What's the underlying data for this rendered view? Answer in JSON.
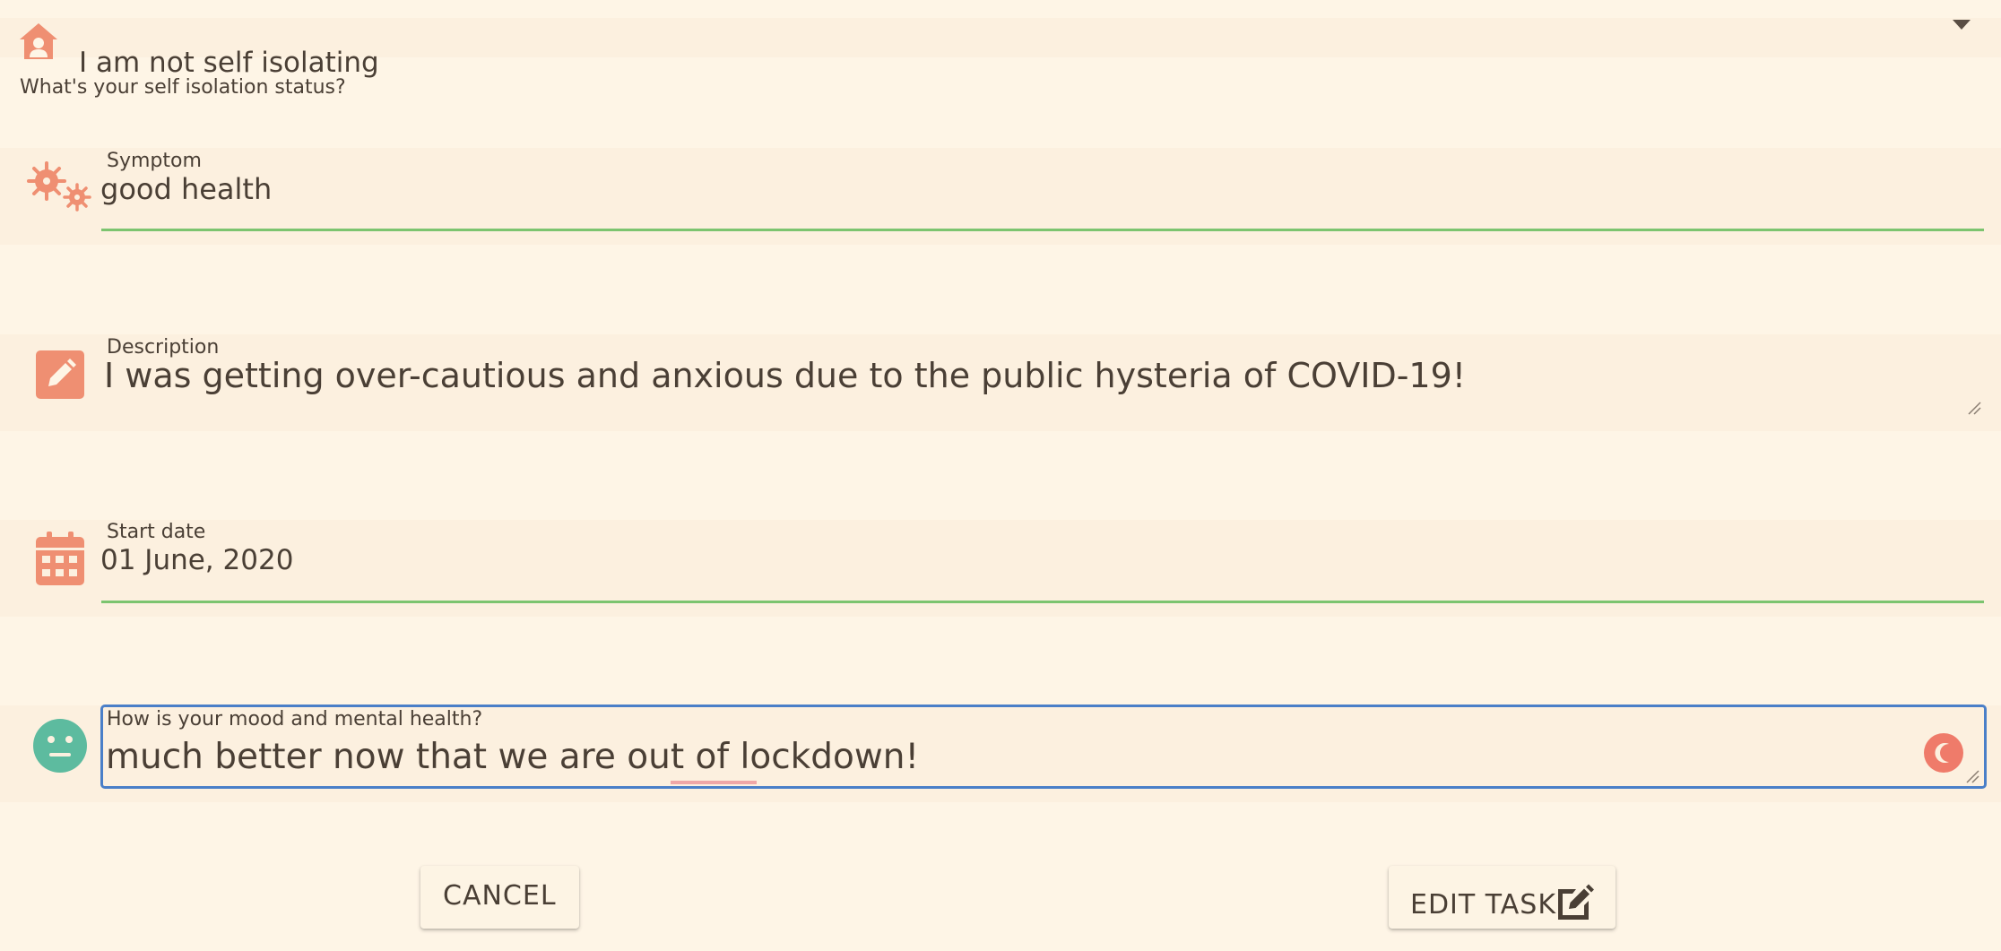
{
  "isolation": {
    "value": "I am not self isolating",
    "helper": "What's your self isolation status?",
    "icon": "home-person-icon"
  },
  "symptom": {
    "label": "Symptom",
    "value": "good health",
    "icon": "virus-icon"
  },
  "description": {
    "label": "Description",
    "value": "I was getting over-cautious and anxious due to the public hysteria of COVID-19!",
    "icon": "pencil-icon"
  },
  "start_date": {
    "label": "Start date",
    "value": "01 June, 2020",
    "icon": "calendar-icon"
  },
  "mood": {
    "label": "How is your mood and mental health?",
    "value": "much better now that we are out of lockdown!",
    "icon": "neutral-face-icon"
  },
  "actions": {
    "cancel_label": "CANCEL",
    "edit_label": "EDIT TASK"
  },
  "colors": {
    "background": "#fef5e6",
    "field_background": "#fcf0df",
    "accent_orange": "#ef8f72",
    "underline_green": "#7cc46f",
    "focus_blue": "#4a7fc8",
    "mood_teal": "#5dbb9f",
    "text": "#4a3f35"
  }
}
